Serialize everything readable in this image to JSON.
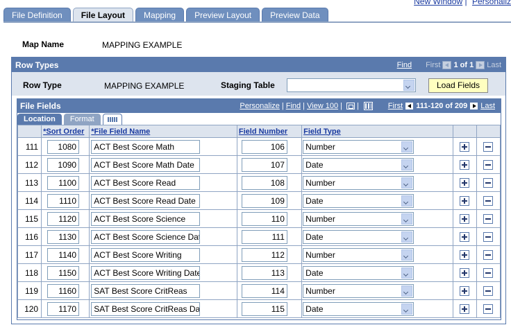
{
  "top_links": {
    "new_window": "New Window",
    "separator": "|",
    "personalize": "Personaliz"
  },
  "tabs": [
    {
      "label": "File Definition",
      "active": false
    },
    {
      "label": "File Layout",
      "active": true
    },
    {
      "label": "Mapping",
      "active": false
    },
    {
      "label": "Preview Layout",
      "active": false
    },
    {
      "label": "Preview Data",
      "active": false
    }
  ],
  "map": {
    "label": "Map Name",
    "value": "MAPPING EXAMPLE"
  },
  "row_types": {
    "title": "Row Types",
    "find": "Find",
    "first": "First",
    "range": "1 of 1",
    "last": "Last",
    "row_type_label": "Row Type",
    "row_type_value": "MAPPING EXAMPLE",
    "staging_label": "Staging Table",
    "staging_value": "",
    "load_button": "Load Fields"
  },
  "file_fields": {
    "title": "File Fields",
    "personalize": "Personalize",
    "find": "Find",
    "view": "View 100",
    "first": "First",
    "range": "111-120 of 209",
    "last": "Last",
    "tab_location": "Location",
    "tab_format": "Format",
    "columns": {
      "sort_order": "*Sort Order",
      "file_field_name": "*File Field Name",
      "field_number": "Field Number",
      "field_type": "Field Type"
    },
    "rows": [
      {
        "num": "111",
        "sort": "1080",
        "name": "ACT Best Score Math",
        "field_num": "106",
        "type": "Number"
      },
      {
        "num": "112",
        "sort": "1090",
        "name": "ACT Best Score Math Date",
        "field_num": "107",
        "type": "Date"
      },
      {
        "num": "113",
        "sort": "1100",
        "name": "ACT Best Score Read",
        "field_num": "108",
        "type": "Number"
      },
      {
        "num": "114",
        "sort": "1110",
        "name": "ACT Best Score Read Date",
        "field_num": "109",
        "type": "Date"
      },
      {
        "num": "115",
        "sort": "1120",
        "name": "ACT Best Score Science",
        "field_num": "110",
        "type": "Number"
      },
      {
        "num": "116",
        "sort": "1130",
        "name": "ACT Best Score Science Dat",
        "field_num": "111",
        "type": "Date"
      },
      {
        "num": "117",
        "sort": "1140",
        "name": "ACT Best Score Writing",
        "field_num": "112",
        "type": "Number"
      },
      {
        "num": "118",
        "sort": "1150",
        "name": "ACT Best Score Writing Date",
        "field_num": "113",
        "type": "Date"
      },
      {
        "num": "119",
        "sort": "1160",
        "name": "SAT Best Score CritReas",
        "field_num": "114",
        "type": "Number"
      },
      {
        "num": "120",
        "sort": "1170",
        "name": "SAT Best Score CritReas Da",
        "field_num": "115",
        "type": "Date"
      }
    ]
  }
}
